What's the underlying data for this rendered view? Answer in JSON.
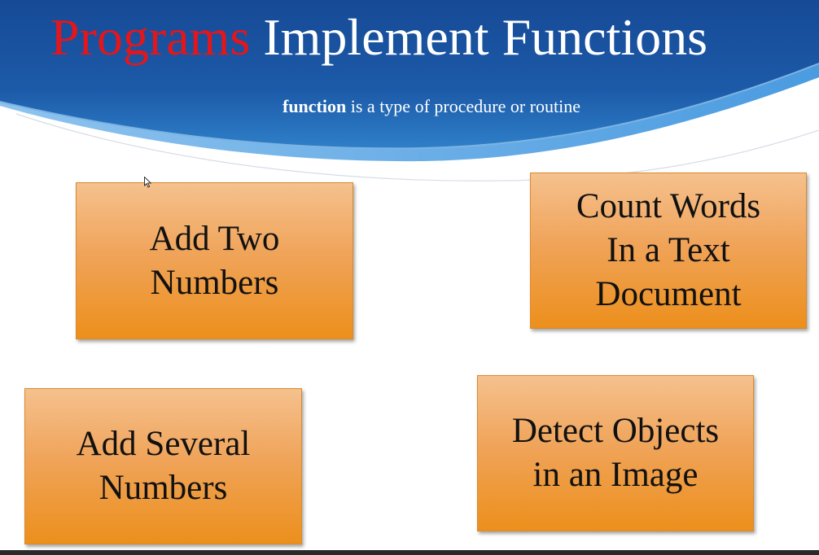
{
  "slide": {
    "title_accent": "Programs",
    "title_rest": " Implement Functions",
    "subtitle_bold": "function",
    "subtitle_rest": " is a type of procedure or routine",
    "colors": {
      "title_accent": "#e3161c",
      "header_blue": "#1b4f9c",
      "box_orange": "#ec8f1c"
    }
  },
  "boxes": [
    {
      "label": "Add Two\nNumbers"
    },
    {
      "label": "Count Words\nIn a Text\nDocument"
    },
    {
      "label": "Add Several\nNumbers"
    },
    {
      "label": "Detect Objects\nin an Image"
    }
  ],
  "cursor": {
    "icon": "mouse-pointer-icon"
  }
}
